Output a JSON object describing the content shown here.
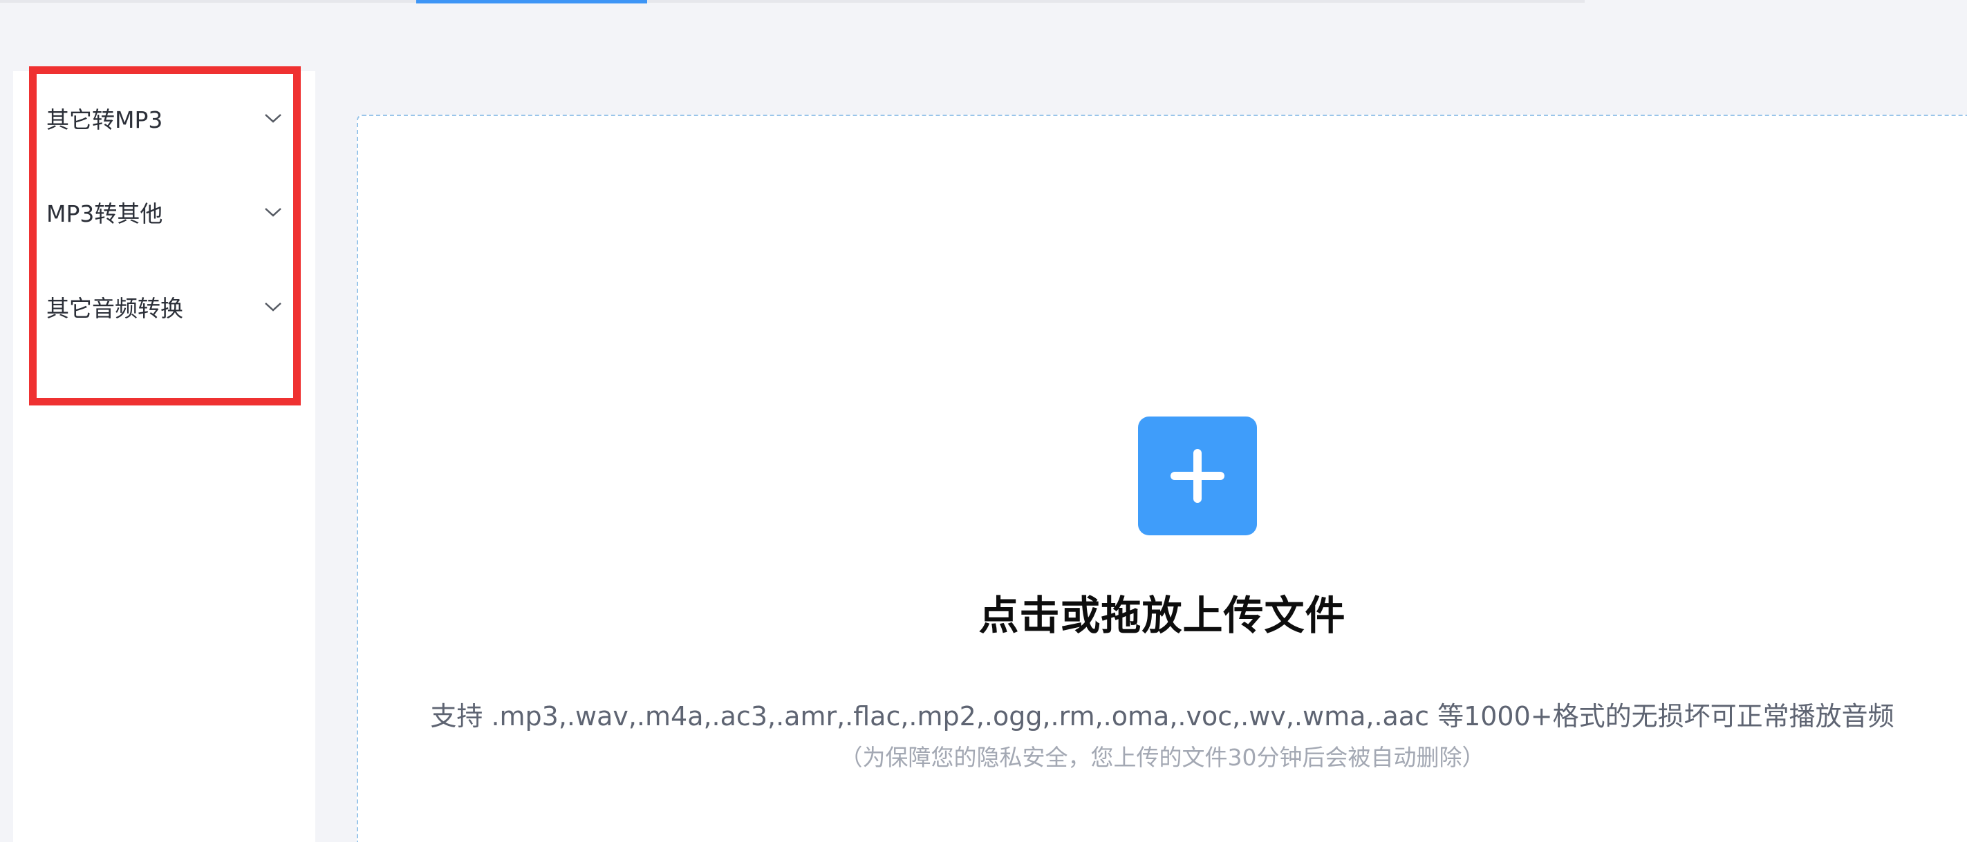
{
  "colors": {
    "page_background": "#f3f4f8",
    "accent": "#3f9dfa",
    "highlight_border": "#ef3131",
    "dashed_border": "#99c5ea"
  },
  "sidebar": {
    "items": [
      {
        "label": "其它转MP3",
        "icon": "chevron-down-icon"
      },
      {
        "label": "MP3转其他",
        "icon": "chevron-down-icon"
      },
      {
        "label": "其它音频转换",
        "icon": "chevron-down-icon"
      }
    ]
  },
  "upload": {
    "icon": "plus-icon",
    "title": "点击或拖放上传文件",
    "formats": "支持 .mp3,.wav,.m4a,.ac3,.amr,.flac,.mp2,.ogg,.rm,.oma,.voc,.wv,.wma,.aac 等1000+格式的无损坏可正常播放音频",
    "privacy_note": "（为保障您的隐私安全，您上传的文件30分钟后会被自动删除）"
  }
}
